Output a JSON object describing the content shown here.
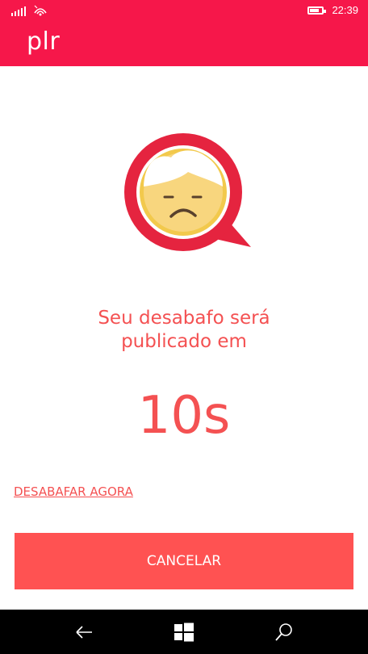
{
  "status_bar": {
    "time": "22:39"
  },
  "header": {
    "app_title": "plr"
  },
  "main": {
    "headline_line1": "Seu desabafo será",
    "headline_line2": "publicado em",
    "countdown": "10s",
    "post_now_link": "DESABAFAR AGORA",
    "cancel_label": "CANCELAR"
  },
  "nav": {
    "back_icon": "back-arrow-icon",
    "home_icon": "windows-logo-icon",
    "search_icon": "search-icon"
  },
  "colors": {
    "brand": "#f6174a",
    "accent": "#f45152",
    "button": "#ff5252",
    "face": "#f8d67e",
    "face_ring": "#f2c94c"
  }
}
